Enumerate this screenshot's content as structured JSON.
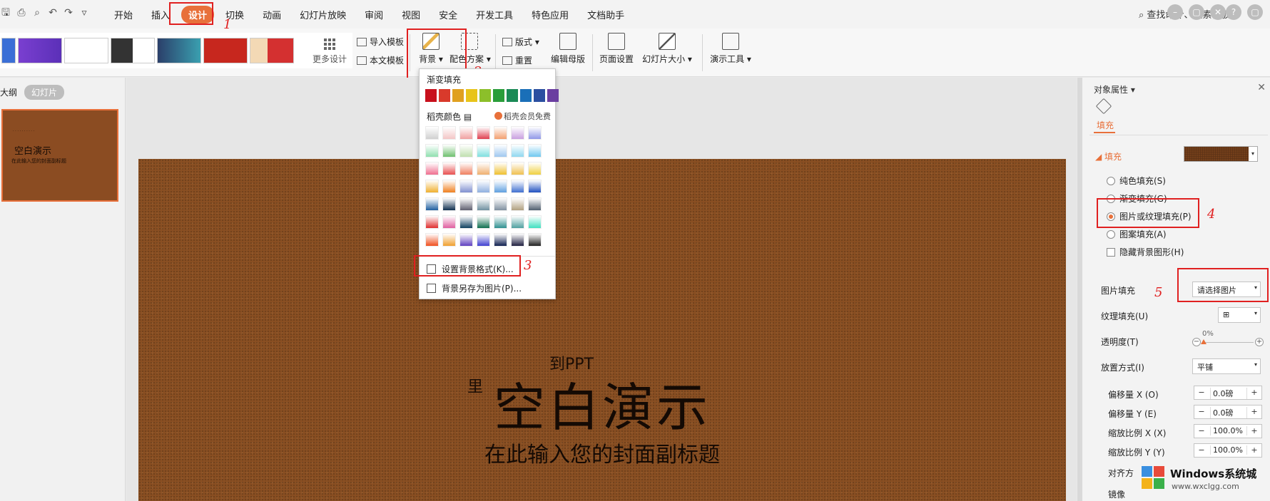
{
  "menu": {
    "items": [
      "开始",
      "插入",
      "设计",
      "切换",
      "动画",
      "幻灯片放映",
      "审阅",
      "视图",
      "安全",
      "开发工具",
      "特色应用",
      "文档助手"
    ],
    "active": "设计",
    "search_text": "查找命令、搜索模板"
  },
  "ribbon": {
    "more_design": "更多设计",
    "import_template": "导入模板",
    "this_text_template": "本文模板",
    "background": "背景",
    "color_scheme": "配色方案",
    "layout": "版式",
    "reset": "重置",
    "edit_master": "编辑母版",
    "page_setup": "页面设置",
    "slide_size": "幻灯片大小",
    "presenter_tools": "演示工具"
  },
  "left_panel": {
    "tab_outline": "大纲",
    "tab_slides": "幻灯片",
    "thumb_title": "空白演示",
    "thumb_subtitle": "在此输入您的封面副标题"
  },
  "slide": {
    "title": "空白演示",
    "subtitle": "在此输入您的封面副标题",
    "partial_text_1": "到PPT",
    "partial_text_2": "里"
  },
  "dropdown": {
    "gradient_fill": "渐变填充",
    "daoke_colors": "稻壳颜色",
    "vip_free": "稻壳会员免费",
    "set_background_format": "设置背景格式(K)...",
    "save_background_as_picture": "背景另存为图片(P)...",
    "solid_row": [
      "#c8101c",
      "#d93a2b",
      "#e0a020",
      "#e8c41a",
      "#8cbf2a",
      "#2a9d3a",
      "#1a8a56",
      "#1a6fb8",
      "#2b4fa0",
      "#6a3ea0"
    ],
    "gradient_rows": [
      [
        "#d0d0d0",
        "#f3c6c6",
        "#f0a0a0",
        "#e04050",
        "#f3a070",
        "#c9a0e0",
        "#9098e8"
      ],
      [
        "#90e0b0",
        "#70c070",
        "#c0e0b0",
        "#80e0e0",
        "#a0c8f0",
        "#90d8f0",
        "#70c8f0"
      ],
      [
        "#f07090",
        "#e85050",
        "#f08060",
        "#f0b070",
        "#f0c030",
        "#f0c050",
        "#f0d040"
      ],
      [
        "#f0b030",
        "#f08020",
        "#8090d0",
        "#90b0e0",
        "#60a0e0",
        "#4070d0",
        "#2050c0"
      ],
      [
        "#2060a0",
        "#103050",
        "#606070",
        "#7090a0",
        "#8090a0",
        "#b0a080",
        "#506070"
      ],
      [
        "#e03030",
        "#e060a0",
        "#104060",
        "#107050",
        "#309090",
        "#50a0a0",
        "#40e0c0"
      ],
      [
        "#f05020",
        "#f0a030",
        "#6040c0",
        "#4040d0",
        "#102050",
        "#202040",
        "#202020"
      ]
    ]
  },
  "right_panel": {
    "title": "对象属性",
    "tab_fill": "填充",
    "section_fill": "填充",
    "options": [
      "纯色填充(S)",
      "渐变填充(G)",
      "图片或纹理填充(P)",
      "图案填充(A)"
    ],
    "selected_option": "图片或纹理填充(P)",
    "hide_bg_graphics": "隐藏背景图形(H)",
    "picture_fill_label": "图片填充",
    "picture_fill_value": "请选择图片",
    "texture_fill_label": "纹理填充(U)",
    "transparency_label": "透明度(T)",
    "transparency_value": "0%",
    "placement_label": "放置方式(I)",
    "placement_value": "平铺",
    "offset_x_label": "偏移量 X (O)",
    "offset_x_value": "0.0磅",
    "offset_y_label": "偏移量 Y (E)",
    "offset_y_value": "0.0磅",
    "scale_x_label": "缩放比例 X (X)",
    "scale_x_value": "100.0%",
    "scale_y_label": "缩放比例 Y (Y)",
    "scale_y_value": "100.0%",
    "align_label": "对齐方",
    "mirror_label": "镜像"
  },
  "annotations": [
    "1",
    "2",
    "3",
    "4",
    "5"
  ],
  "watermark": {
    "line1": "Windows系统城",
    "line2": "www.wxclgg.com"
  },
  "colors": {
    "accent": "#e8703a",
    "annotation_red": "#e02020",
    "leather": "#8a4f22"
  }
}
